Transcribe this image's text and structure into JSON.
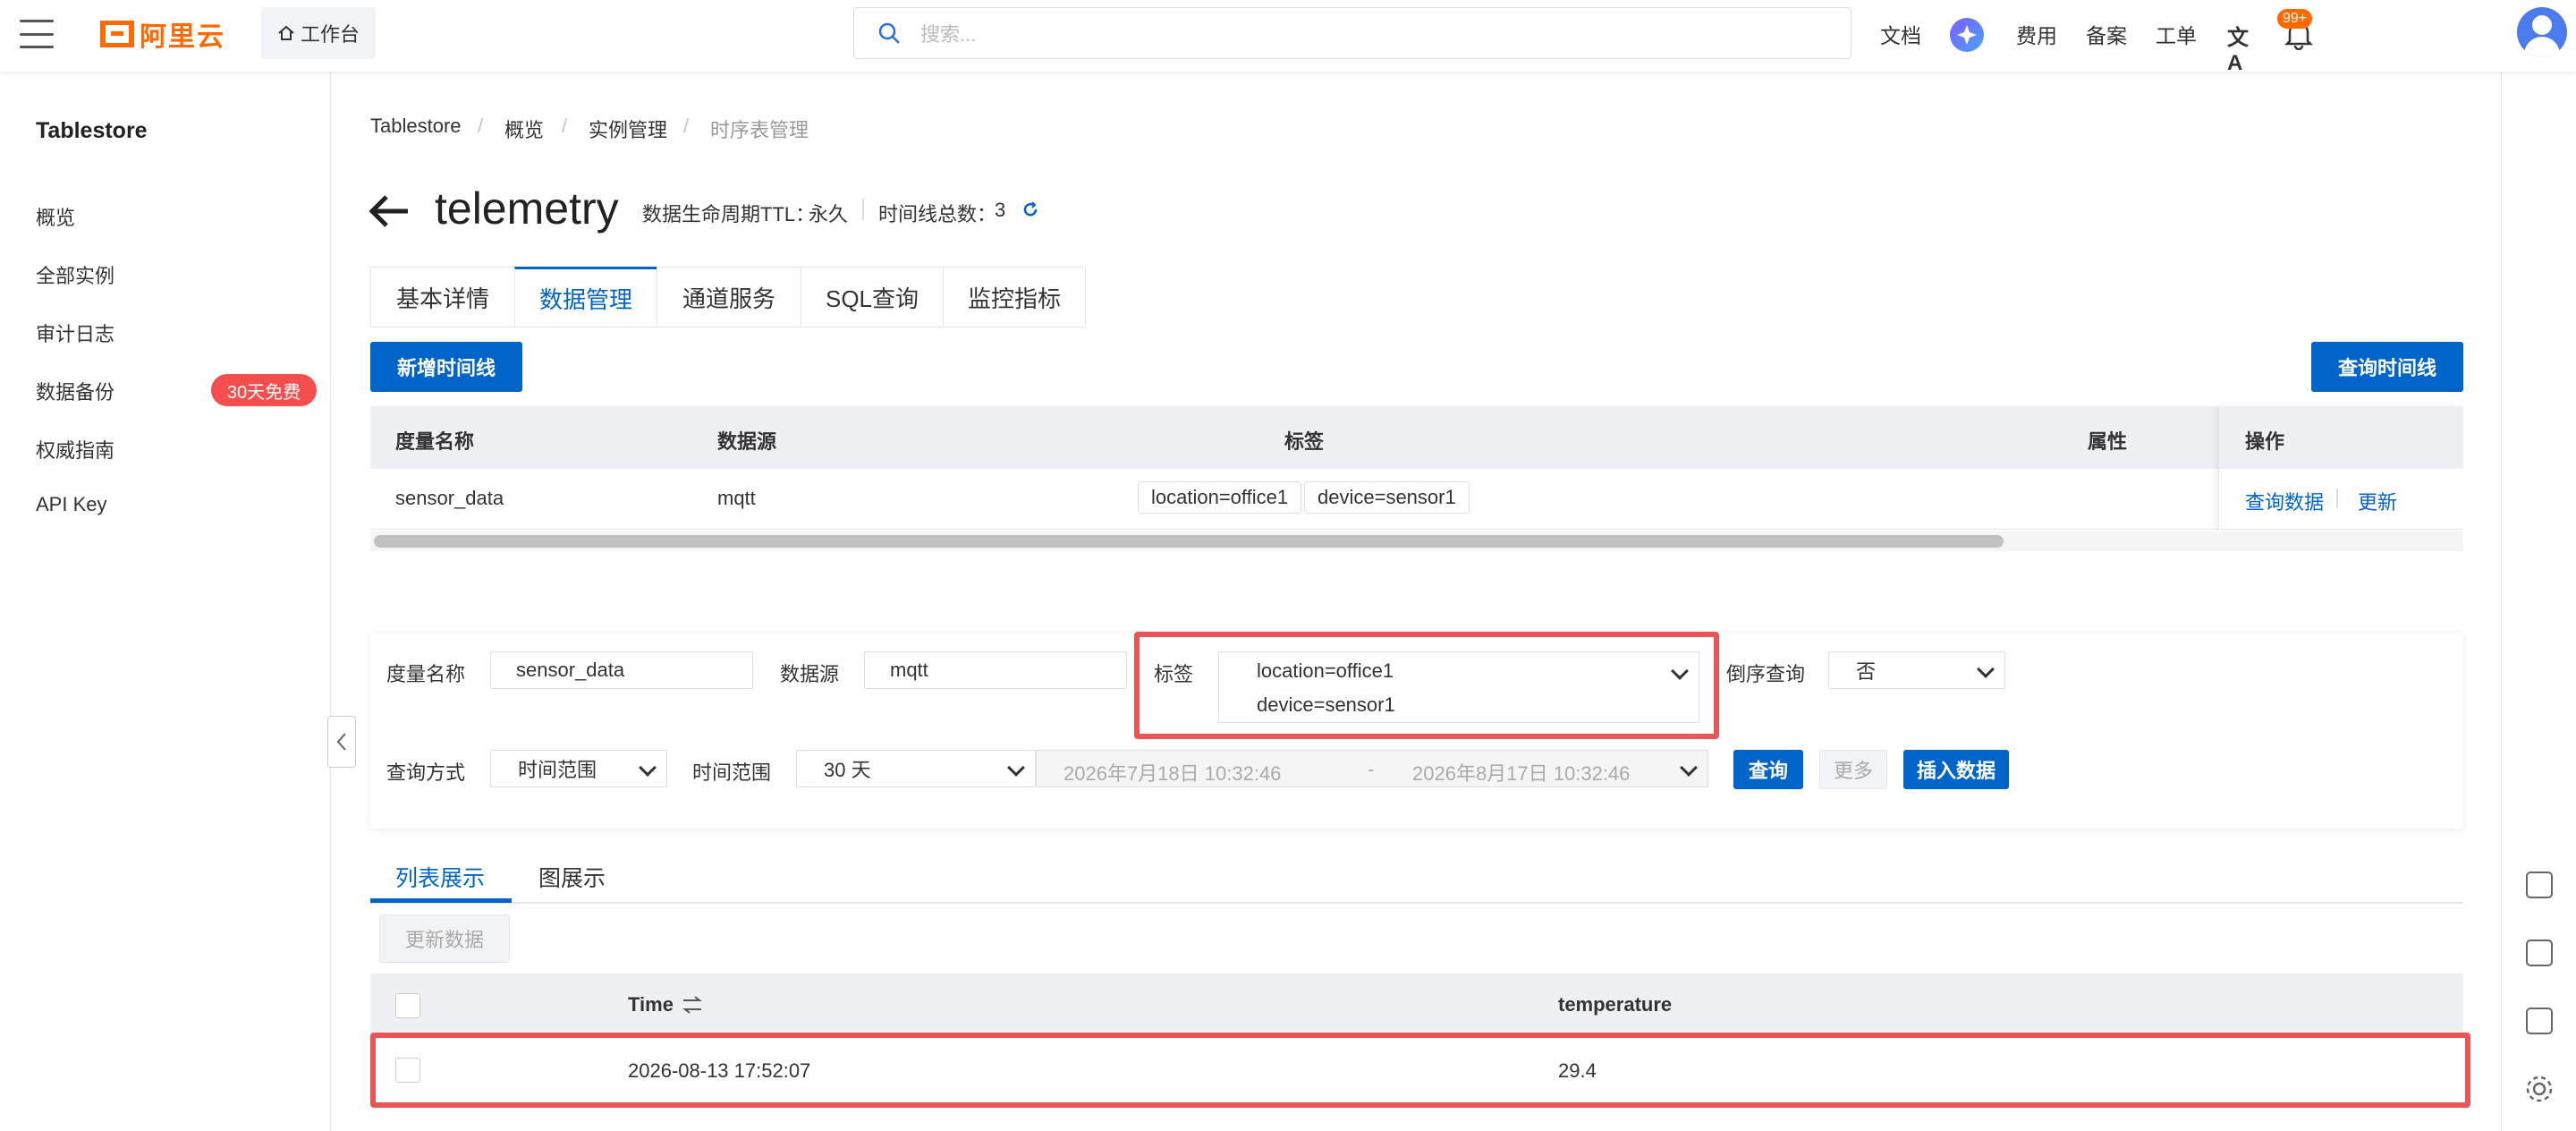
{
  "topbar": {
    "logo_text": "阿里云",
    "workbench_label": "工作台",
    "search_placeholder": "搜索...",
    "nav": [
      "文档",
      "费用",
      "备案",
      "工单"
    ],
    "notification_badge": "99+"
  },
  "sidebar": {
    "title": "Tablestore",
    "items": [
      {
        "label": "概览"
      },
      {
        "label": "全部实例"
      },
      {
        "label": "审计日志"
      },
      {
        "label": "数据备份",
        "badge": "30天免费"
      },
      {
        "label": "权威指南"
      },
      {
        "label": "API Key"
      }
    ]
  },
  "breadcrumb": [
    "Tablestore",
    "概览",
    "实例管理",
    "时序表管理"
  ],
  "header": {
    "title": "telemetry",
    "ttl_label": "数据生命周期TTL：",
    "ttl_value": "永久",
    "timeline_count_label": "时间线总数：",
    "timeline_count_value": "3"
  },
  "tabs": [
    "基本详情",
    "数据管理",
    "通道服务",
    "SQL查询",
    "监控指标"
  ],
  "active_tab": "数据管理",
  "actions": {
    "add_timeline": "新增时间线",
    "query_timeline": "查询时间线"
  },
  "timeline_table": {
    "columns": [
      "度量名称",
      "数据源",
      "标签",
      "属性",
      "操作"
    ],
    "rows": [
      {
        "measure": "sensor_data",
        "source": "mqtt",
        "tags": [
          "location=office1",
          "device=sensor1"
        ],
        "attributes": "",
        "ops": [
          "查询数据",
          "更新"
        ]
      }
    ]
  },
  "query": {
    "measure_label": "度量名称",
    "measure_value": "sensor_data",
    "source_label": "数据源",
    "source_value": "mqtt",
    "tags_label": "标签",
    "tags_value": [
      "location=office1",
      "device=sensor1"
    ],
    "reverse_label": "倒序查询",
    "reverse_value": "否",
    "mode_label": "查询方式",
    "mode_value": "时间范围",
    "range_label": "时间范围",
    "range_value": "30 天",
    "date_start": "2026年7月18日 10:32:46",
    "date_sep": "-",
    "date_end": "2026年8月17日 10:32:46",
    "query_button": "查询",
    "more_button": "更多",
    "insert_button": "插入数据"
  },
  "result_tabs": [
    "列表展示",
    "图展示"
  ],
  "result": {
    "refresh_button": "更新数据",
    "columns": [
      "Time",
      "temperature"
    ],
    "rows": [
      {
        "time": "2026-08-13 17:52:07",
        "temperature": "29.4"
      }
    ]
  },
  "colors": {
    "primary": "#0064c8",
    "brand": "#ff6a00",
    "highlight": "#e95454",
    "badge": "#f54e4e"
  }
}
